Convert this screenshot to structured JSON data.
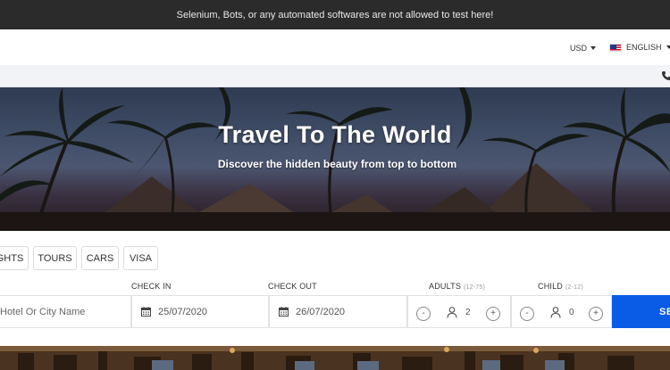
{
  "warning": {
    "text": "Selenium, Bots, or any automated softwares are not allowed to test here!"
  },
  "topbar": {
    "currency": "USD",
    "language": "ENGLISH"
  },
  "hero": {
    "title": "Travel To The World",
    "subtitle": "Discover the hidden beauty from top to bottom"
  },
  "tabs": [
    "GHTS",
    "TOURS",
    "CARS",
    "VISA"
  ],
  "search": {
    "hotel_placeholder": "Hotel Or City Name",
    "checkin_label": "CHECK IN",
    "checkin_value": "25/07/2020",
    "checkout_label": "CHECK OUT",
    "checkout_value": "26/07/2020",
    "adults_label": "ADULTS",
    "adults_range": "(12-75)",
    "adults_value": "2",
    "child_label": "CHILD",
    "child_range": "(2-12)",
    "child_value": "0",
    "minus": "-",
    "plus": "+",
    "search_label": "SE"
  },
  "colors": {
    "accent": "#0a5ce6",
    "warning_bg": "#2b2b2b"
  },
  "icons": [
    "phone-icon",
    "calendar-icon",
    "person-icon",
    "us-flag-icon"
  ]
}
